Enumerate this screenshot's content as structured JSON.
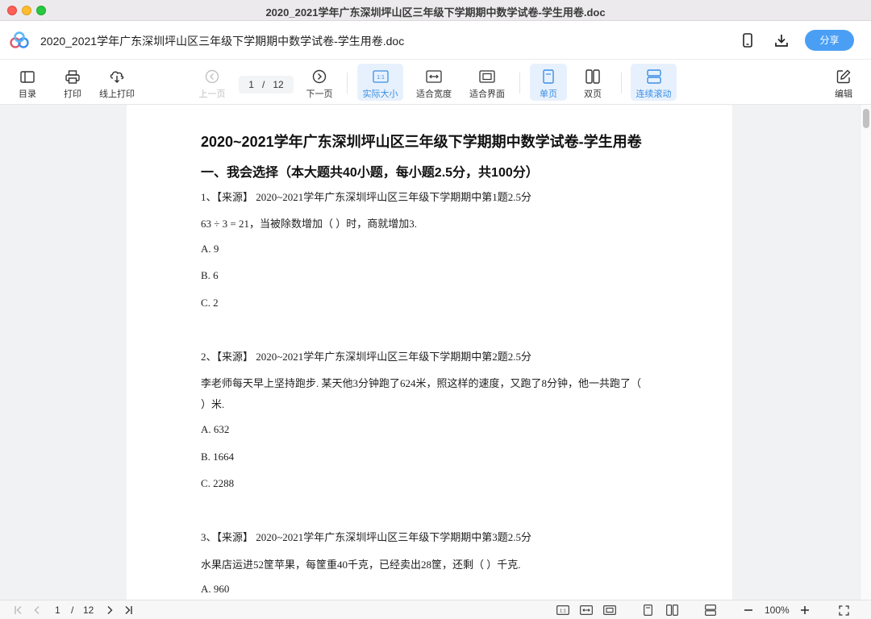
{
  "window": {
    "title": "2020_2021学年广东深圳坪山区三年级下学期期中数学试卷-学生用卷.doc"
  },
  "header": {
    "doc_title": "2020_2021学年广东深圳坪山区三年级下学期期中数学试卷-学生用卷.doc",
    "share_label": "分享",
    "icons": [
      "phone-icon",
      "download-icon"
    ]
  },
  "toolbar": {
    "toc_label": "目录",
    "print_label": "打印",
    "online_print_label": "线上打印",
    "prev_label": "上一页",
    "current_page": "1",
    "page_sep": "/",
    "total_pages": "12",
    "next_label": "下一页",
    "actual_size_label": "实际大小",
    "actual_size_icon_text": "1:1",
    "fit_width_label": "适合宽度",
    "fit_page_label": "适合界面",
    "single_label": "单页",
    "double_label": "双页",
    "continuous_label": "连续滚动",
    "edit_label": "编辑",
    "accent": "#3a8ee6"
  },
  "document": {
    "title": "2020~2021学年广东深圳坪山区三年级下学期期中数学试卷-学生用卷",
    "section": "一、我会选择（本大题共40小题，每小题2.5分，共100分）",
    "lines": [
      "1、【来源】 2020~2021学年广东深圳坪山区三年级下学期期中第1题2.5分",
      " 63  ÷  3  =  21，当被除数增加（    ）时，商就增加3.",
      "A.  9",
      "B.  6",
      "C.  2",
      "2、【来源】 2020~2021学年广东深圳坪山区三年级下学期期中第2题2.5分",
      "李老师每天早上坚持跑步. 某天他3分钟跑了624米，照这样的速度，又跑了8分钟，他一共跑了（",
      "    ）米.",
      "A.  632",
      "B.  1664",
      "C.  2288",
      "3、【来源】 2020~2021学年广东深圳坪山区三年级下学期期中第3题2.5分",
      "水果店运进52筐苹果，每筐重40千克，已经卖出28筐，还剩（    ）千克.",
      "A.  960"
    ]
  },
  "statusbar": {
    "current_page": "1",
    "page_sep": "/",
    "total_pages": "12",
    "zoom": "100%",
    "actual_size_icon_text": "1:1"
  }
}
